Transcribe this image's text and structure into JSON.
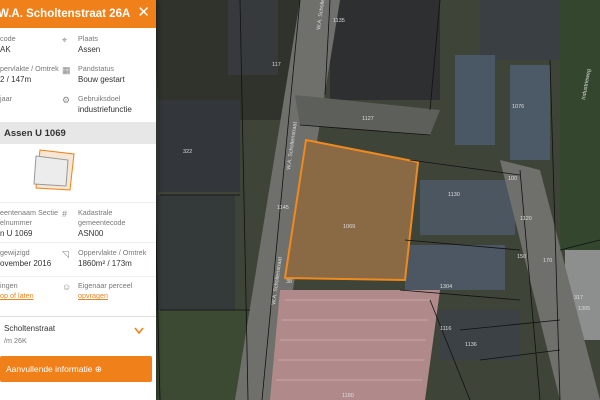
{
  "header": {
    "title": "W.A. Scholtenstraat 26A",
    "close": "✕"
  },
  "info": {
    "code_label": "code",
    "code_value": "AK",
    "plaats_label": "Plaats",
    "plaats_value": "Assen",
    "area_label": "pervlakte / Omtrek",
    "area_value": "2 / 147m",
    "status_label": "Pandstatus",
    "status_value": "Bouw gestart",
    "year_label": "jaar",
    "use_label": "Gebruiksdoel",
    "use_value": "industriefunctie"
  },
  "parcel": {
    "title": "Assen U 1069",
    "gemeente_label_1": "eentenaam Sectie",
    "gemeente_label_2": "elnummer",
    "gemeente_value": "n U 1069",
    "kad_label_1": "Kadastrale",
    "kad_label_2": "gemeentecode",
    "kad_value": "ASN00",
    "changed_label": "gewijzigd",
    "changed_value": "ovember 2016",
    "opp_label": "Oppervlakte / Omtrek",
    "opp_value": "1860m² / 173m",
    "owner_label_left": "ingen",
    "owner_link_left": "op of laten",
    "owner_label": "Eigenaar perceel",
    "owner_link": "opvragen"
  },
  "address": {
    "line1": "Scholtenstraat",
    "line2": "/m 26K"
  },
  "button": {
    "label": "Aanvullende informatie ⊕"
  },
  "map": {
    "labels": {
      "street_a": "W.A. Scholtenstraat",
      "street_b": "W.A. Scholtenstraat",
      "street_c": "W.A. Scholtenstraat",
      "street_d": "Industrieweg",
      "n1": "117",
      "n2": "1135",
      "n3": "1127",
      "n4": "1076",
      "n5": "322",
      "n6": "1069",
      "n7": "1130",
      "n8": "1145",
      "n9": "150",
      "n10": "170",
      "n11": "1304",
      "n12": "1116",
      "n13": "1136",
      "n14": "317",
      "n15": "1305",
      "n16": "1120",
      "n17": "1180",
      "n18": "38",
      "n19": "100"
    }
  },
  "colors": {
    "accent": "#f0801a",
    "parcel_fill": "#8a6a45",
    "road": "#6f6f6c"
  }
}
